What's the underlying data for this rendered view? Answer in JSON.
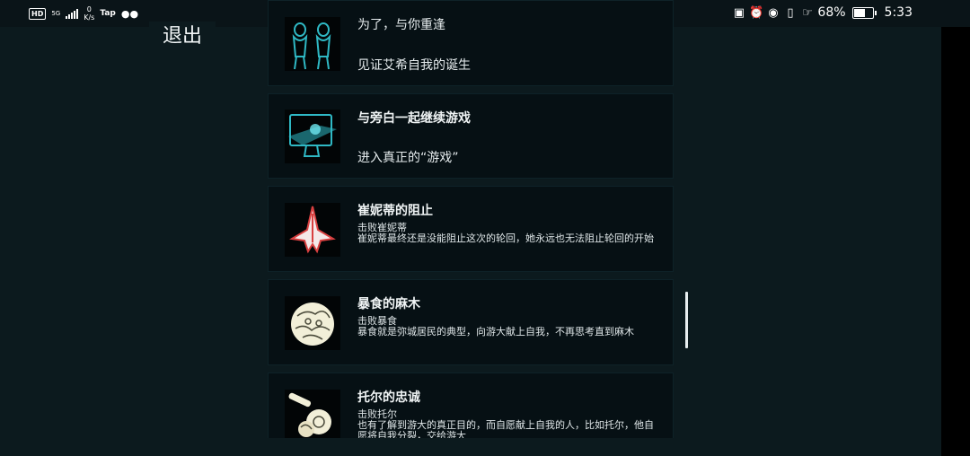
{
  "status_bar": {
    "hd": "HD",
    "network": "5G",
    "speed_value": "0",
    "speed_unit": "K/s",
    "tap_label": "Tap",
    "battery_percent": "68%",
    "battery_level": 0.68,
    "time": "5:33"
  },
  "exit_label": "退出",
  "achievements": [
    {
      "title": "为了，与你重逢",
      "desc": "见证艾希自我的诞生",
      "icon": "twin-figures-icon"
    },
    {
      "title": "与旁白一起继续游戏",
      "desc": "进入真正的“游戏”",
      "icon": "monitor-icon"
    },
    {
      "title": "崔妮蒂的阻止",
      "line1": "击败崔妮蒂",
      "line2": "崔妮蒂最终还是没能阻止这次的轮回，她永远也无法阻止轮回的开始",
      "icon": "red-ship-icon"
    },
    {
      "title": "暴食的麻木",
      "line1": "击败暴食",
      "line2": "暴食就是弥城居民的典型，向游大献上自我，不再思考直到麻木",
      "icon": "gluttony-creature-icon"
    },
    {
      "title": "托尔的忠诚",
      "line1": "击败托尔",
      "line2": "也有了解到游大的真正目的，而自愿献上自我的人，比如托尔，他自愿将自我分裂，交给游大",
      "icon": "thor-cannon-icon"
    }
  ],
  "colors": {
    "background": "#0c1a1e",
    "card": "#061014",
    "teal_icon": "#2fb8c4",
    "red_icon": "#d94040"
  }
}
